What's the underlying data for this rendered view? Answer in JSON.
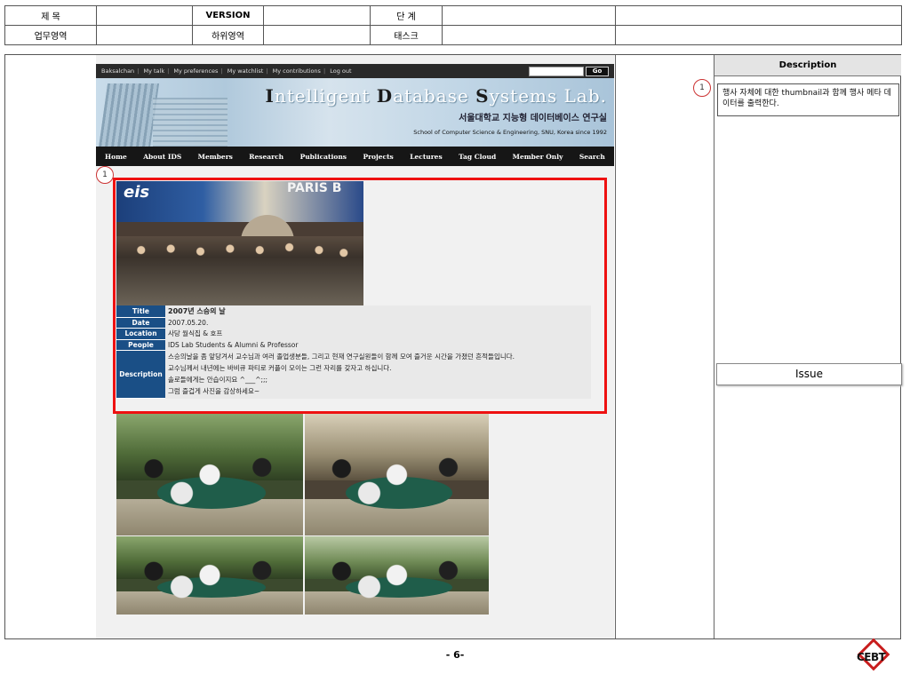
{
  "meta_table": {
    "row1": {
      "label1": "제 목",
      "value1": "",
      "label2": "VERSION",
      "value2": "",
      "label3": "단 계",
      "value3": "",
      "value4": ""
    },
    "row2": {
      "label1": "업무영역",
      "value1": "",
      "label2": "하위영역",
      "value2": "",
      "label3": "태스크",
      "value3": "",
      "value4": ""
    }
  },
  "site": {
    "topbar": {
      "links": [
        "Baksalchan",
        "My talk",
        "My preferences",
        "My watchlist",
        "My contributions",
        "Log out"
      ],
      "search_placeholder": "",
      "go_label": "Go"
    },
    "banner": {
      "title_parts": [
        {
          "initial": "I",
          "rest": "ntelligent"
        },
        {
          "initial": "D",
          "rest": "atabase"
        },
        {
          "initial": "S",
          "rest": "ystems Lab."
        }
      ],
      "title_ko": "서울대학교 지능형 데이터베이스 연구실",
      "subtitle": "School of Computer Science & Engineering, SNU, Korea since 1992"
    },
    "nav": [
      "Home",
      "About IDS",
      "Members",
      "Research",
      "Publications",
      "Projects",
      "Lectures",
      "Tag Cloud",
      "Member Only",
      "Search"
    ],
    "thumbnail": {
      "sign_left": "eis",
      "sign_right": "PARIS B"
    },
    "event": {
      "rows": [
        {
          "key": "Title",
          "value": "2007년 스승의 날"
        },
        {
          "key": "Date",
          "value": "2007.05.20."
        },
        {
          "key": "Location",
          "value": "사당 월식집 & 호프"
        },
        {
          "key": "People",
          "value": "IDS Lab Students & Alumni & Professor"
        }
      ],
      "description_key": "Description",
      "description_lines": [
        "스승의날을 좀 앞당겨서 교수님과 여러 졸업생분들, 그리고 현재 연구실원들이 함께 모여 즐거운 시간을 가졌던 흔적들입니다.",
        "교수님께서 내년에는 바비큐 파티로 커플이 모이는 그런 자리를 갖자고 하십니다.",
        "솔로들에게는 안습이지요 ^___^;;;",
        "그럼 즐겁게 사진을 감상하세요~"
      ]
    }
  },
  "annotations": {
    "marker_1": "1",
    "marker_2": "1"
  },
  "right_panel": {
    "description_header": "Description",
    "description_text": "행사 자체에 대한 thumbnail과 함께 행사 메타 데이터를 출력한다.",
    "issue_header": "Issue"
  },
  "footer": {
    "page_number": "- 6-",
    "logo_text": "CEBT"
  },
  "colors": {
    "highlight_border": "#e11111",
    "info_key_bg": "#1a4f86",
    "navbar_bg": "#161616",
    "marker_border": "#cc3333",
    "logo_red": "#c81d1d"
  }
}
